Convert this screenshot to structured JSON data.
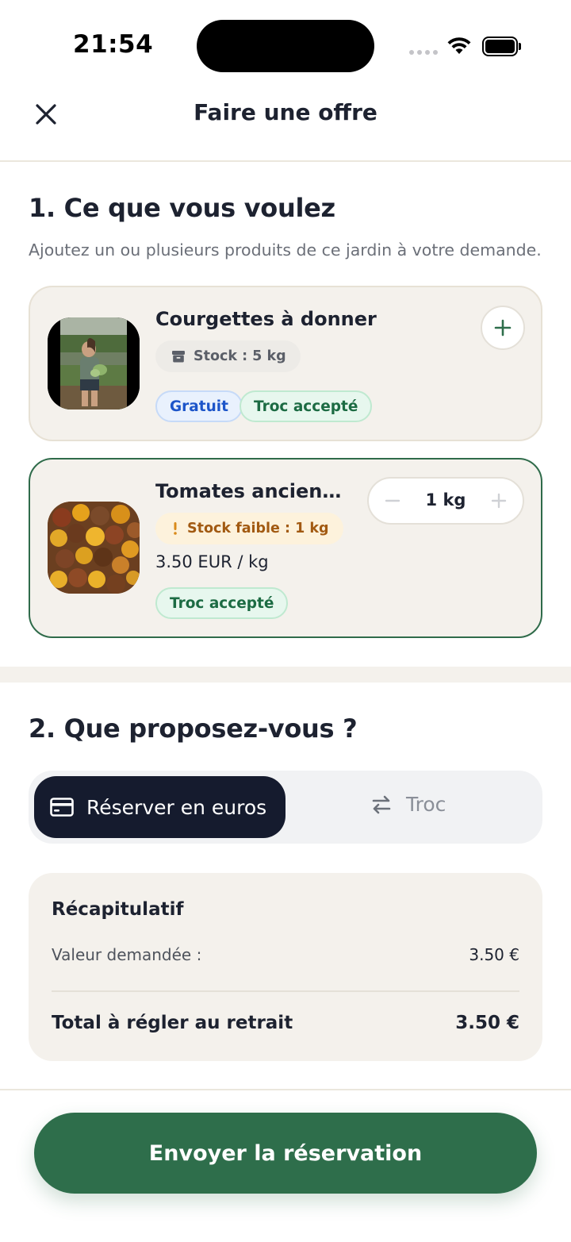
{
  "status_bar": {
    "time": "21:54"
  },
  "header": {
    "title": "Faire une offre"
  },
  "section1": {
    "title": "1. Ce que vous voulez",
    "subtitle": "Ajoutez un ou plusieurs produits de ce jardin à votre demande.",
    "products": [
      {
        "name": "Courgettes à donner",
        "stock": "Stock : 5 kg",
        "tags": [
          "Gratuit",
          "Troc accepté"
        ]
      },
      {
        "name": "Tomates anciennes",
        "stock": "Stock faible : 1 kg",
        "price": "3.50 EUR / kg",
        "tags": [
          "Troc accepté"
        ],
        "quantity": "1 kg"
      }
    ]
  },
  "section2": {
    "title": "2. Que proposez-vous ?",
    "options": {
      "euros": "Réserver en euros",
      "troc": "Troc"
    },
    "selected": "euros"
  },
  "summary": {
    "title": "Récapitulatif",
    "requested_label": "Valeur demandée :",
    "requested_value": "3.50 €",
    "total_label": "Total à régler au retrait",
    "total_value": "3.50 €"
  },
  "submit": {
    "label": "Envoyer la réservation"
  },
  "colors": {
    "primary_green": "#2e6e4b",
    "dark_navy": "#151b2e",
    "card_beige": "#f4f1ec",
    "warning_orange": "#a25a12",
    "tag_blue": "#1d55c9"
  }
}
